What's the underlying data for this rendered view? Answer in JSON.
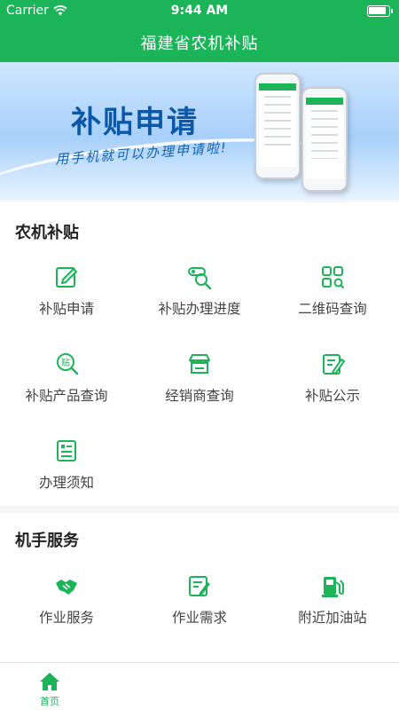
{
  "status_bar": {
    "carrier": "Carrier",
    "time": "9:44 AM"
  },
  "header": {
    "title": "福建省农机补贴"
  },
  "banner": {
    "title": "补贴申请",
    "subtitle": "用手机就可以办理申请啦!"
  },
  "sections": [
    {
      "title": "农机补贴",
      "items": [
        {
          "label": "补贴申请",
          "icon": "edit-icon"
        },
        {
          "label": "补贴办理进度",
          "icon": "search-progress-icon"
        },
        {
          "label": "二维码查询",
          "icon": "qr-code-icon"
        },
        {
          "label": "补贴产品查询",
          "icon": "subsidy-search-icon"
        },
        {
          "label": "经销商查询",
          "icon": "shop-icon"
        },
        {
          "label": "补贴公示",
          "icon": "notice-icon"
        },
        {
          "label": "办理须知",
          "icon": "document-icon"
        }
      ]
    },
    {
      "title": "机手服务",
      "items": [
        {
          "label": "作业服务",
          "icon": "handshake-icon"
        },
        {
          "label": "作业需求",
          "icon": "demand-icon"
        },
        {
          "label": "附近加油站",
          "icon": "gas-station-icon"
        }
      ]
    }
  ],
  "tabbar": {
    "items": [
      {
        "label": "首页",
        "icon": "home-icon",
        "active": true
      }
    ]
  },
  "colors": {
    "brand": "#1bb458",
    "banner_text": "#0c58a8"
  }
}
